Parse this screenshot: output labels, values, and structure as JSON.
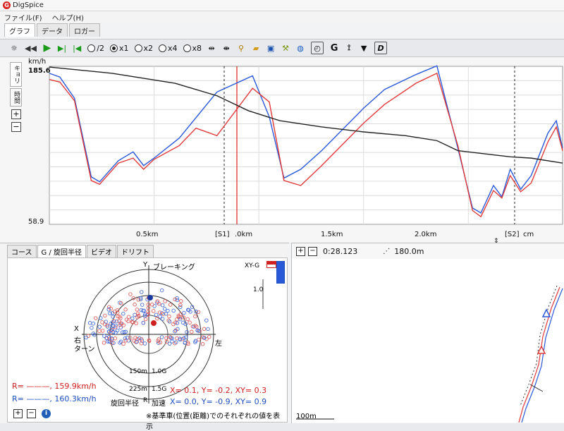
{
  "app": {
    "title": "DigSpice"
  },
  "menu": {
    "file": "ファイル(F)",
    "help": "ヘルプ(H)"
  },
  "main_tabs": [
    "グラフ",
    "データ",
    "ロガー"
  ],
  "toolbar": {
    "speeds": [
      {
        "label": "/2",
        "selected": false
      },
      {
        "label": "x1",
        "selected": true
      },
      {
        "label": "x2",
        "selected": false
      },
      {
        "label": "x4",
        "selected": false
      },
      {
        "label": "x8",
        "selected": false
      }
    ],
    "g_label": "G",
    "d_label": "D"
  },
  "graph": {
    "side_tabs": [
      "キョリ",
      "時間"
    ],
    "y_unit": "km/h",
    "y_max": "185.6",
    "y_min": "58.9",
    "x_ticks": [
      "0.5km",
      "[S1]",
      ".0km",
      "1.5km",
      "2.0km",
      "[S2]",
      "cm"
    ]
  },
  "chart_data": {
    "type": "line",
    "x_unit": "km",
    "y_unit": "km/h",
    "ylim": [
      58.9,
      185.6
    ],
    "xlim": [
      0,
      2.45
    ],
    "grid": true,
    "series": [
      {
        "color": "#2a59d8",
        "points": [
          [
            0.0,
            180
          ],
          [
            0.05,
            177
          ],
          [
            0.12,
            160
          ],
          [
            0.2,
            97
          ],
          [
            0.24,
            93
          ],
          [
            0.33,
            110
          ],
          [
            0.4,
            117
          ],
          [
            0.45,
            106
          ],
          [
            0.5,
            112
          ],
          [
            0.62,
            128
          ],
          [
            0.8,
            165
          ],
          [
            0.97,
            178
          ],
          [
            1.05,
            145
          ],
          [
            1.12,
            96
          ],
          [
            1.2,
            103
          ],
          [
            1.3,
            118
          ],
          [
            1.5,
            152
          ],
          [
            1.6,
            167
          ],
          [
            1.75,
            179
          ],
          [
            1.85,
            186
          ],
          [
            1.95,
            120
          ],
          [
            2.02,
            72
          ],
          [
            2.06,
            68
          ],
          [
            2.12,
            90
          ],
          [
            2.16,
            81
          ],
          [
            2.2,
            103
          ],
          [
            2.25,
            87
          ],
          [
            2.3,
            98
          ],
          [
            2.38,
            132
          ],
          [
            2.42,
            142
          ],
          [
            2.45,
            120
          ]
        ]
      },
      {
        "color": "#e03a3a",
        "points": [
          [
            0.0,
            175
          ],
          [
            0.05,
            173
          ],
          [
            0.12,
            158
          ],
          [
            0.2,
            94
          ],
          [
            0.24,
            91
          ],
          [
            0.33,
            108
          ],
          [
            0.4,
            112
          ],
          [
            0.45,
            103
          ],
          [
            0.5,
            111
          ],
          [
            0.62,
            122
          ],
          [
            0.7,
            136
          ],
          [
            0.8,
            130
          ],
          [
            0.97,
            168
          ],
          [
            1.05,
            157
          ],
          [
            1.12,
            94
          ],
          [
            1.2,
            90
          ],
          [
            1.3,
            106
          ],
          [
            1.5,
            140
          ],
          [
            1.6,
            155
          ],
          [
            1.75,
            172
          ],
          [
            1.85,
            180
          ],
          [
            1.95,
            122
          ],
          [
            2.02,
            70
          ],
          [
            2.06,
            65
          ],
          [
            2.12,
            86
          ],
          [
            2.16,
            80
          ],
          [
            2.2,
            98
          ],
          [
            2.25,
            85
          ],
          [
            2.3,
            92
          ],
          [
            2.38,
            125
          ],
          [
            2.42,
            137
          ],
          [
            2.45,
            118
          ]
        ]
      },
      {
        "color": "#222222",
        "points": [
          [
            0.0,
            185
          ],
          [
            0.3,
            180
          ],
          [
            0.6,
            172
          ],
          [
            0.8,
            162
          ],
          [
            0.95,
            150
          ],
          [
            1.1,
            142
          ],
          [
            1.3,
            137
          ],
          [
            1.5,
            133
          ],
          [
            1.7,
            130
          ],
          [
            1.85,
            126
          ],
          [
            1.95,
            118
          ],
          [
            2.05,
            116
          ],
          [
            2.2,
            113
          ],
          [
            2.3,
            112
          ],
          [
            2.45,
            108
          ]
        ]
      }
    ]
  },
  "g_panel": {
    "tabs": [
      "コース",
      "G / 旋回半径",
      "ビデオ",
      "ドリフト"
    ],
    "y_label": "Y",
    "top_label": "ブレーキング",
    "x_label": "X",
    "left_label_1": "右",
    "left_label_2": "ターン",
    "right_label": "左",
    "ring_1g": "1.0G",
    "ring_15g": "1.5G",
    "ring_150": "150m",
    "ring_225": "225m",
    "turn_label": "旋回半径",
    "r_label": "R",
    "accel_label": "加速",
    "xyg_label": "XY-G",
    "bar_value": "1.0",
    "r_red": "R= ———, 159.9km/h",
    "r_blue": "R= ———, 160.3km/h",
    "xy_red": "X=  0.1, Y= -0.2, XY= 0.3",
    "xy_blue": "X=  0.0, Y= -0.9, XY= 0.9",
    "note": "※基準車(位置(距離)でのそれぞれの値を表示"
  },
  "course_panel": {
    "time": "0:28.123",
    "distance": "180.0m",
    "scale": "100m"
  }
}
